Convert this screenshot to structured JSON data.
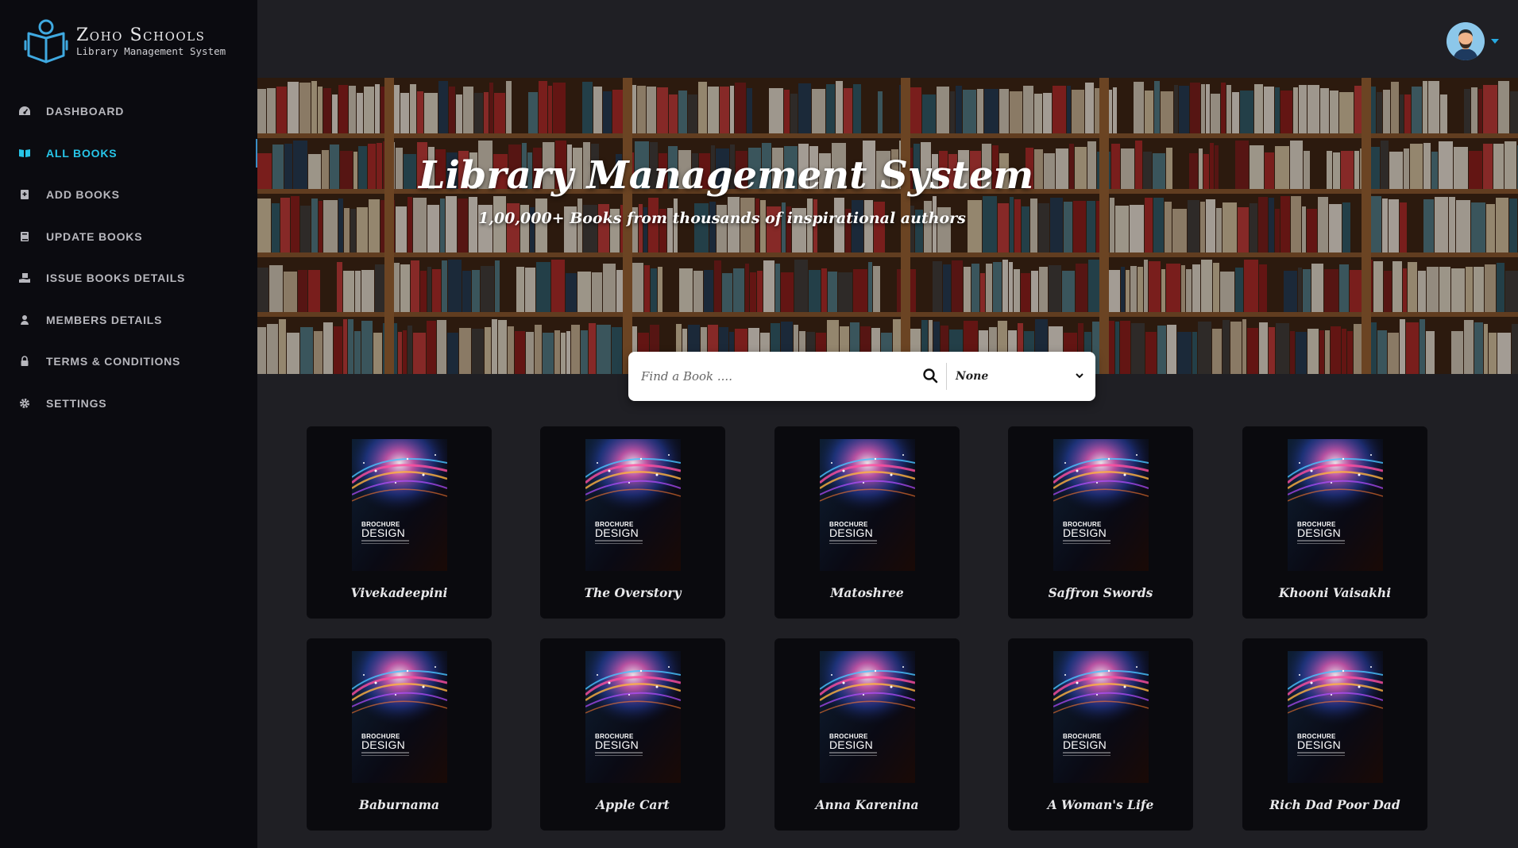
{
  "brand": {
    "name": "Zoho Schools",
    "subtitle": "Library Management System"
  },
  "sidebar": {
    "items": [
      {
        "label": "DASHBOARD",
        "icon": "dashboard-icon"
      },
      {
        "label": "ALL BOOKS",
        "icon": "book-open-icon",
        "active": true
      },
      {
        "label": "ADD BOOKS",
        "icon": "book-add-icon"
      },
      {
        "label": "UPDATE BOOKS",
        "icon": "book-icon"
      },
      {
        "label": "ISSUE BOOKS DETAILS",
        "icon": "hand-book-icon"
      },
      {
        "label": "MEMBERS DETAILS",
        "icon": "user-icon"
      },
      {
        "label": "TERMS & CONDITIONS",
        "icon": "lock-icon"
      },
      {
        "label": "SETTINGS",
        "icon": "gear-icon"
      }
    ]
  },
  "header": {
    "avatar": "user-avatar",
    "menu_icon": "caret-down-icon"
  },
  "hero": {
    "title": "Library Management System",
    "subtitle": "1,00,000+ Books from thousands of inspirational authors"
  },
  "search": {
    "placeholder": "Find a Book ....",
    "value": "",
    "filter_selected": "None"
  },
  "cover": {
    "line1": "BROCHURE",
    "line2": "DESIGN"
  },
  "books": [
    {
      "title": "Vivekadeepini"
    },
    {
      "title": "The Overstory"
    },
    {
      "title": "Matoshree"
    },
    {
      "title": "Saffron Swords"
    },
    {
      "title": "Khooni Vaisakhi"
    },
    {
      "title": "Baburnama"
    },
    {
      "title": "Apple Cart"
    },
    {
      "title": "Anna Karenina"
    },
    {
      "title": "A Woman's Life"
    },
    {
      "title": "Rich Dad Poor Dad"
    }
  ],
  "colors": {
    "accent": "#27c5e8",
    "sidebar_bg": "#0b0b10",
    "main_bg": "#1f1f24",
    "card_bg": "#0a0a0e"
  }
}
